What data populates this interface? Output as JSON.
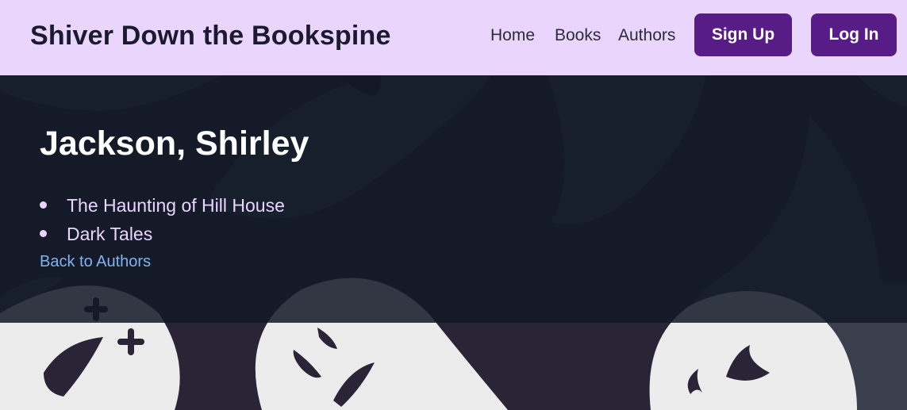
{
  "header": {
    "site_title": "Shiver Down the Bookspine",
    "nav": {
      "home": "Home",
      "books": "Books",
      "authors": "Authors"
    },
    "signup_label": "Sign Up",
    "login_label": "Log In"
  },
  "main": {
    "author_name": "Jackson, Shirley",
    "books": [
      {
        "title": "The Haunting of Hill House"
      },
      {
        "title": "Dark Tales"
      }
    ],
    "back_link": "Back to Authors"
  },
  "colors": {
    "header_bg": "#ead6fd",
    "accent_button": "#581c87",
    "panel_bg": "#111827",
    "book_text": "#e9d5ff",
    "link": "#7fb4f0",
    "ghost_light": "#ececec",
    "ghost_dark": "#2a2536"
  }
}
